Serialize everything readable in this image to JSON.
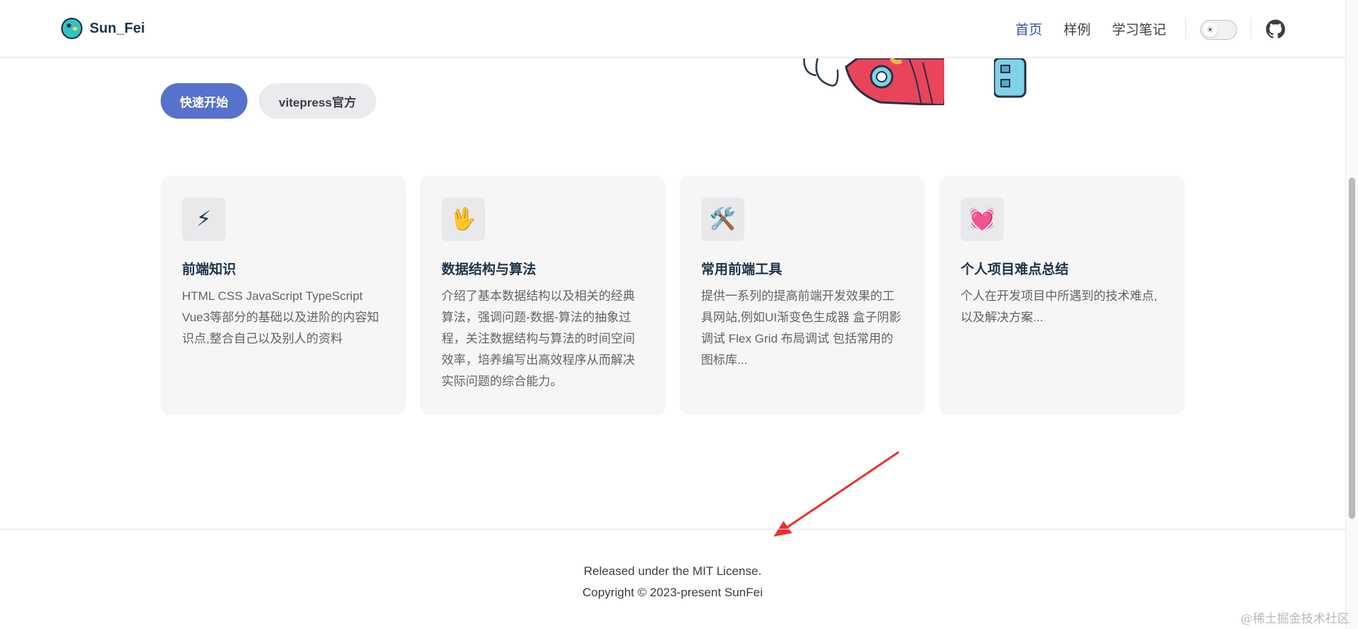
{
  "nav": {
    "site_title": "Sun_Fei",
    "links": [
      {
        "label": "首页",
        "active": true
      },
      {
        "label": "样例",
        "active": false
      },
      {
        "label": "学习笔记",
        "active": false
      }
    ],
    "icons": {
      "theme_toggle": "sun-icon",
      "github": "github-icon"
    }
  },
  "hero": {
    "actions": [
      {
        "label": "快速开始",
        "theme": "brand"
      },
      {
        "label": "vitepress官方",
        "theme": "alt"
      }
    ]
  },
  "features": [
    {
      "icon": "⚡",
      "icon_name": "lightning-icon",
      "title": "前端知识",
      "details": "HTML CSS JavaScript TypeScript Vue3等部分的基础以及进阶的内容知识点,整合自己以及别人的资料"
    },
    {
      "icon": "🖖",
      "icon_name": "vulcan-salute-icon",
      "title": "数据结构与算法",
      "details": "介绍了基本数据结构以及相关的经典算法，强调问题-数据-算法的抽象过程，关注数据结构与算法的时间空间效率，培养编写出高效程序从而解决实际问题的综合能力。"
    },
    {
      "icon": "🛠️",
      "icon_name": "tools-icon",
      "title": "常用前端工具",
      "details": "提供一系列的提高前端开发效果的工具网站,例如UI渐变色生成器 盒子阴影调试 Flex Grid 布局调试 包括常用的图标库..."
    },
    {
      "icon": "💓",
      "icon_name": "beating-heart-icon",
      "title": "个人项目难点总结",
      "details": "个人在开发项目中所遇到的技术难点,以及解决方案..."
    }
  ],
  "footer": {
    "message": "Released under the MIT License.",
    "copyright": "Copyright © 2023-present SunFei"
  },
  "watermark": "@稀土掘金技术社区",
  "colors": {
    "brand": "#5672cd",
    "nav_active": "#3451b2",
    "arrow": "#e8332c"
  }
}
